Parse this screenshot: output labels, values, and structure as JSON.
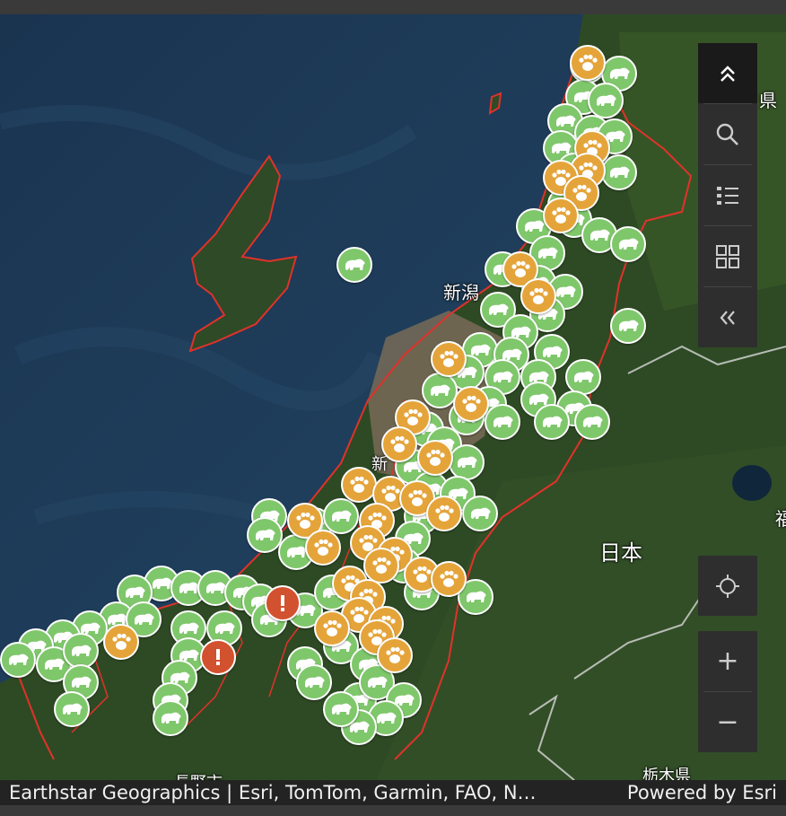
{
  "map": {
    "labels": {
      "niigata_city": "新潟",
      "niigata_partial": "新",
      "japan": "日本",
      "ken_top": "県",
      "tochigi": "栃木県",
      "nagano": "長野市",
      "right_edge": "福"
    }
  },
  "markers": {
    "bear": "bear-marker",
    "paw": "paw-marker",
    "alert": "alert-marker"
  },
  "colors": {
    "sea": "#1e3a55",
    "land": "#2f4a26",
    "urban": "#7a6a55",
    "boundary": "#e0322a",
    "bear_marker": "#7fc76b",
    "paw_marker": "#e5a43a",
    "alert_marker": "#d2512e"
  },
  "toolbar": {
    "buttons": [
      {
        "name": "collapse-up",
        "icon": "double-chevron-up-icon"
      },
      {
        "name": "search",
        "icon": "search-icon"
      },
      {
        "name": "legend",
        "icon": "legend-list-icon"
      },
      {
        "name": "basemap",
        "icon": "basemap-gallery-icon"
      },
      {
        "name": "collapse-left",
        "icon": "double-chevron-left-icon"
      }
    ],
    "locate_icon": "locate-icon",
    "zoom_in_label": "+",
    "zoom_out_label": "−"
  },
  "attribution": {
    "sources": "Earthstar Geographics | Esri, TomTom, Garmin, FAO, N…",
    "powered_by": "Powered by Esri"
  }
}
